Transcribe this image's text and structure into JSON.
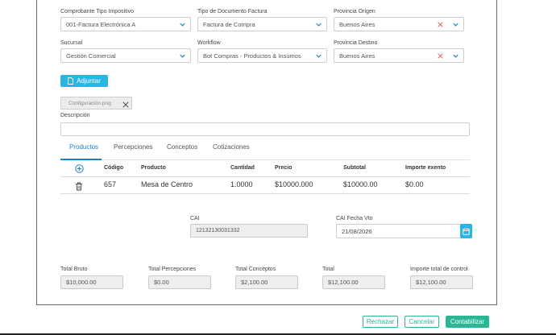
{
  "form": {
    "comprobante": {
      "label": "Comprobante Tipo Impositivo",
      "value": "001-Factura Electrónica A"
    },
    "tipo_documento": {
      "label": "Tipo de Documento Factura",
      "value": "Factura de Compra"
    },
    "provincia_origen": {
      "label": "Provincia Origen",
      "value": "Buenos Aires"
    },
    "sucursal": {
      "label": "Sucursal",
      "value": "Gestión Comercial"
    },
    "workflow": {
      "label": "Workflow",
      "value": "Bot Compras - Productos & Insumos"
    },
    "provincia_destino": {
      "label": "Provincia Destino",
      "value": "Buenos Aires"
    },
    "adjuntar_label": "Adjuntar",
    "attachment_name": "Configuración.png",
    "descripcion_label": "Descripción",
    "descripcion_value": ""
  },
  "tabs": [
    {
      "label": "Productos",
      "active": true
    },
    {
      "label": "Percepciones",
      "active": false
    },
    {
      "label": "Conceptos",
      "active": false
    },
    {
      "label": "Cotizaciones",
      "active": false
    }
  ],
  "table": {
    "headers": [
      "Código",
      "Producto",
      "Cantidad",
      "Precio",
      "Subtotal",
      "Importe exento"
    ],
    "rows": [
      {
        "codigo": "657",
        "producto": "Mesa de Centro",
        "cantidad": "1.0000",
        "precio": "$10000.000",
        "subtotal": "$10000.00",
        "exento": "$0.00"
      }
    ]
  },
  "cai": {
    "label": "CAI",
    "value": "12132130031332"
  },
  "cai_vto": {
    "label": "CAI Fecha Vto",
    "value": "21/08/2026"
  },
  "totals": [
    {
      "label": "Total Bruto",
      "value": "$10,000.00"
    },
    {
      "label": "Total Percepciones",
      "value": "$0.00"
    },
    {
      "label": "Total Conceptos",
      "value": "$2,100.00"
    },
    {
      "label": "Total",
      "value": "$12,100.00"
    },
    {
      "label": "Importe total de control",
      "value": "$12,100.00"
    }
  ],
  "actions": {
    "rechazar": "Rechazar",
    "cancelar": "Cancelar",
    "contabilizar": "Contabilizar"
  },
  "colors": {
    "accent": "#29b6e6",
    "success": "#2bb795",
    "clear_x": "#e05a5a",
    "tab_active": "#1c7fc0"
  },
  "icons": [
    "chevron-down-icon",
    "clear-x-icon",
    "file-icon",
    "close-icon",
    "add-circle-icon",
    "trash-icon",
    "calendar-icon"
  ]
}
